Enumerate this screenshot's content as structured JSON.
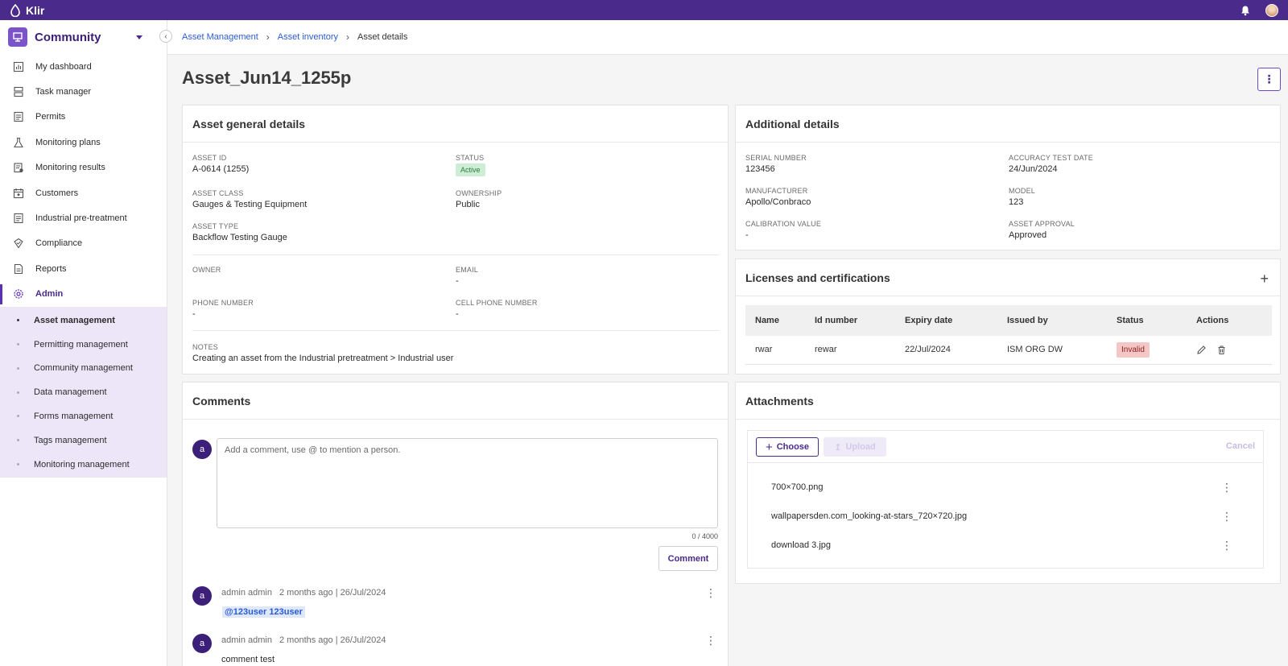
{
  "app": {
    "name": "Klir"
  },
  "sidebar": {
    "community": "Community",
    "items": [
      {
        "label": "My dashboard",
        "icon": "chart-icon"
      },
      {
        "label": "Task manager",
        "icon": "task-icon"
      },
      {
        "label": "Permits",
        "icon": "document-icon"
      },
      {
        "label": "Monitoring plans",
        "icon": "flask-icon"
      },
      {
        "label": "Monitoring results",
        "icon": "clipboard-icon"
      },
      {
        "label": "Customers",
        "icon": "customers-icon"
      },
      {
        "label": "Industrial pre-treatment",
        "icon": "document-icon"
      },
      {
        "label": "Compliance",
        "icon": "compliance-icon"
      },
      {
        "label": "Reports",
        "icon": "report-icon"
      },
      {
        "label": "Admin",
        "icon": "gear-icon"
      }
    ],
    "sub_items": [
      "Asset management",
      "Permitting management",
      "Community management",
      "Data management",
      "Forms management",
      "Tags management",
      "Monitoring management"
    ]
  },
  "breadcrumb": {
    "crumb1": "Asset Management",
    "crumb2": "Asset inventory",
    "current": "Asset details"
  },
  "page": {
    "title": "Asset_Jun14_1255p"
  },
  "general": {
    "title": "Asset general details",
    "asset_id_label": "ASSET ID",
    "asset_id": "A-0614 (1255)",
    "status_label": "STATUS",
    "status": "Active",
    "asset_class_label": "ASSET CLASS",
    "asset_class": "Gauges & Testing Equipment",
    "ownership_label": "OWNERSHIP",
    "ownership": "Public",
    "asset_type_label": "ASSET TYPE",
    "asset_type": "Backflow Testing Gauge",
    "owner_label": "OWNER",
    "email_label": "EMAIL",
    "email": "-",
    "phone_label": "PHONE NUMBER",
    "phone": "-",
    "cell_label": "CELL PHONE NUMBER",
    "cell": "-",
    "notes_label": "NOTES",
    "notes": "Creating an asset from the Industrial pretreatment > Industrial user"
  },
  "additional": {
    "title": "Additional details",
    "serial_label": "SERIAL NUMBER",
    "serial": "123456",
    "accuracy_label": "ACCURACY TEST DATE",
    "accuracy": "24/Jun/2024",
    "manufacturer_label": "MANUFACTURER",
    "manufacturer": "Apollo/Conbraco",
    "model_label": "MODEL",
    "model": "123",
    "calibration_label": "CALIBRATION VALUE",
    "calibration": "-",
    "approval_label": "ASSET APPROVAL",
    "approval": "Approved"
  },
  "licenses": {
    "title": "Licenses and certifications",
    "add": "+",
    "headers": {
      "name": "Name",
      "id": "Id number",
      "expiry": "Expiry date",
      "issued": "Issued by",
      "status": "Status",
      "actions": "Actions"
    },
    "row": {
      "name": "rwar",
      "id": "rewar",
      "expiry": "22/Jul/2024",
      "issued": "ISM ORG DW",
      "status": "Invalid"
    }
  },
  "comments": {
    "title": "Comments",
    "avatar": "a",
    "placeholder": "Add a comment, use @ to mention a person.",
    "counter": "0 / 4000",
    "button": "Comment",
    "list": [
      {
        "author": "admin admin",
        "time": "2 months ago | 26/Jul/2024",
        "mention": "@123user 123user"
      },
      {
        "author": "admin admin",
        "time": "2 months ago | 26/Jul/2024",
        "text": "comment test"
      }
    ]
  },
  "attachments": {
    "title": "Attachments",
    "choose": "Choose",
    "upload": "Upload",
    "cancel": "Cancel",
    "files": [
      "700×700.png",
      "wallpapersden.com_looking-at-stars_720×720.jpg",
      "download 3.jpg"
    ]
  },
  "colors": {
    "brand": "#4a2a8a",
    "accent": "#5b2fb8",
    "link": "#2a5bd7",
    "active_badge": "#cdeed5",
    "invalid_badge": "#f5c6c6"
  }
}
